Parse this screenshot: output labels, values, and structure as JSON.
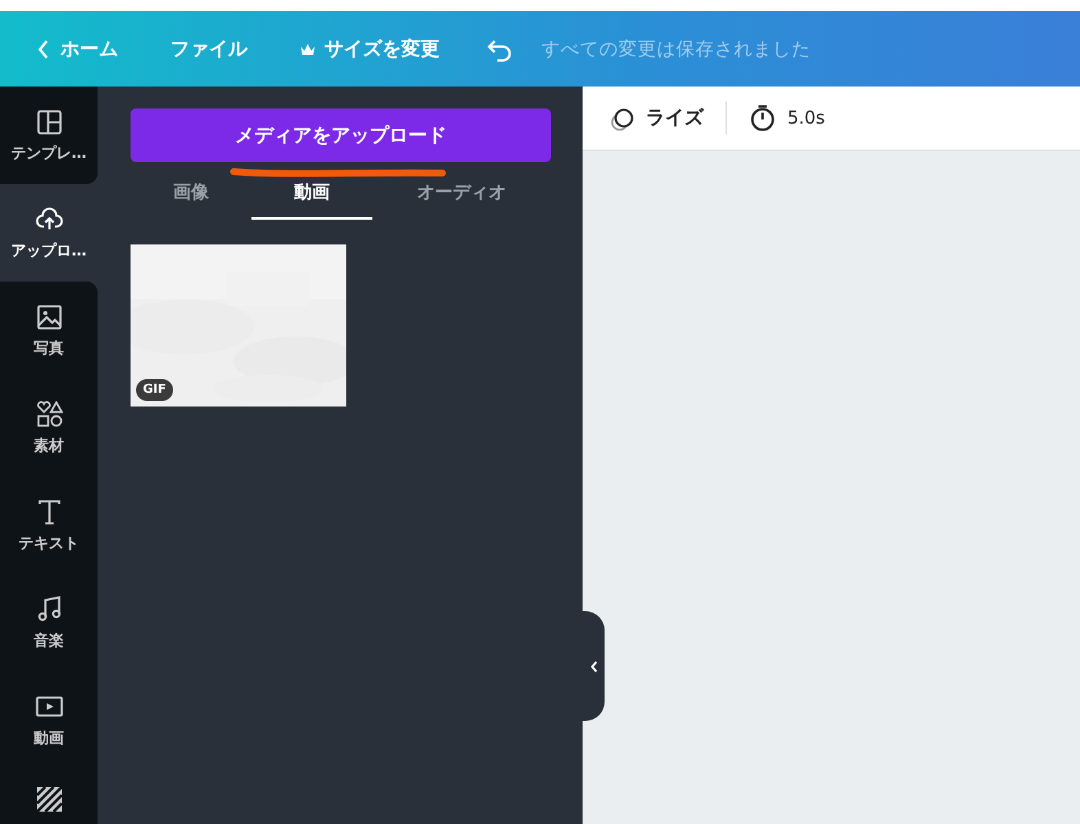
{
  "header": {
    "home": "ホーム",
    "file": "ファイル",
    "resize": "サイズを変更",
    "save_status": "すべての変更は保存されました"
  },
  "nav": [
    {
      "label": "テンプレ…",
      "selected": false
    },
    {
      "label": "アップロ…",
      "selected": true
    },
    {
      "label": "写真",
      "selected": false
    },
    {
      "label": "素材",
      "selected": false
    },
    {
      "label": "テキスト",
      "selected": false
    },
    {
      "label": "音楽",
      "selected": false
    },
    {
      "label": "動画",
      "selected": false
    },
    {
      "selected": false
    }
  ],
  "panel": {
    "upload_button": "メディアをアップロード",
    "tabs": [
      {
        "label": "画像",
        "selected": false
      },
      {
        "label": "動画",
        "selected": true
      },
      {
        "label": "オーディオ",
        "selected": false
      }
    ],
    "items": [
      {
        "kind": "picture",
        "badge": "GIF"
      }
    ]
  },
  "canvas": {
    "animation": "ライズ",
    "duration": "5.0s"
  }
}
